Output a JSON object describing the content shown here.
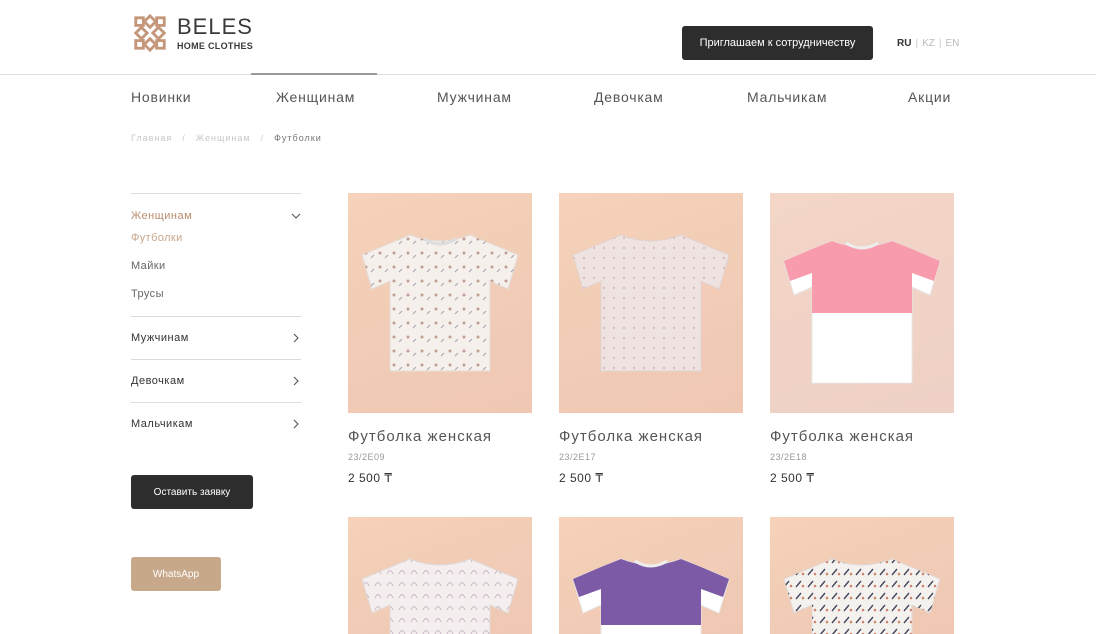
{
  "header": {
    "brand": "BELES",
    "brand_sub": "HOME CLOTHES",
    "coop_button": "Приглашаем к сотрудничеству",
    "languages": [
      "RU",
      "KZ",
      "EN"
    ],
    "active_language": "RU"
  },
  "nav": {
    "items": [
      "Новинки",
      "Женщинам",
      "Мужчинам",
      "Девочкам",
      "Мальчикам",
      "Акции"
    ],
    "active": "Женщинам"
  },
  "breadcrumb": [
    "Главная",
    "Женщинам",
    "Футболки"
  ],
  "sidebar": {
    "sections": [
      {
        "label": "Женщинам",
        "expanded": true,
        "children": [
          "Футболки",
          "Майки",
          "Трусы"
        ],
        "active_child": "Футболки"
      },
      {
        "label": "Мужчинам",
        "expanded": false
      },
      {
        "label": "Девочкам",
        "expanded": false
      },
      {
        "label": "Мальчикам",
        "expanded": false
      }
    ],
    "apply_button": "Оставить заявку",
    "whatsapp_button": "WhatsApp"
  },
  "products": [
    {
      "title": "Футболка женская",
      "code": "23/2E09",
      "price": "2 500 ₸",
      "style": "floral-print"
    },
    {
      "title": "Футболка женская",
      "code": "23/2E17",
      "price": "2 500 ₸",
      "style": "pink-pattern"
    },
    {
      "title": "Футболка женская",
      "code": "23/2E18",
      "price": "2 500 ₸",
      "style": "pink-white-block"
    },
    {
      "style": "leaf-print"
    },
    {
      "style": "purple-white-block"
    },
    {
      "style": "dark-pattern"
    }
  ],
  "colors": {
    "accent": "#b98d6d",
    "dark_button": "#2d2d2d",
    "whatsapp": "#c8a88a",
    "card_bg": "#f3cdb6"
  }
}
